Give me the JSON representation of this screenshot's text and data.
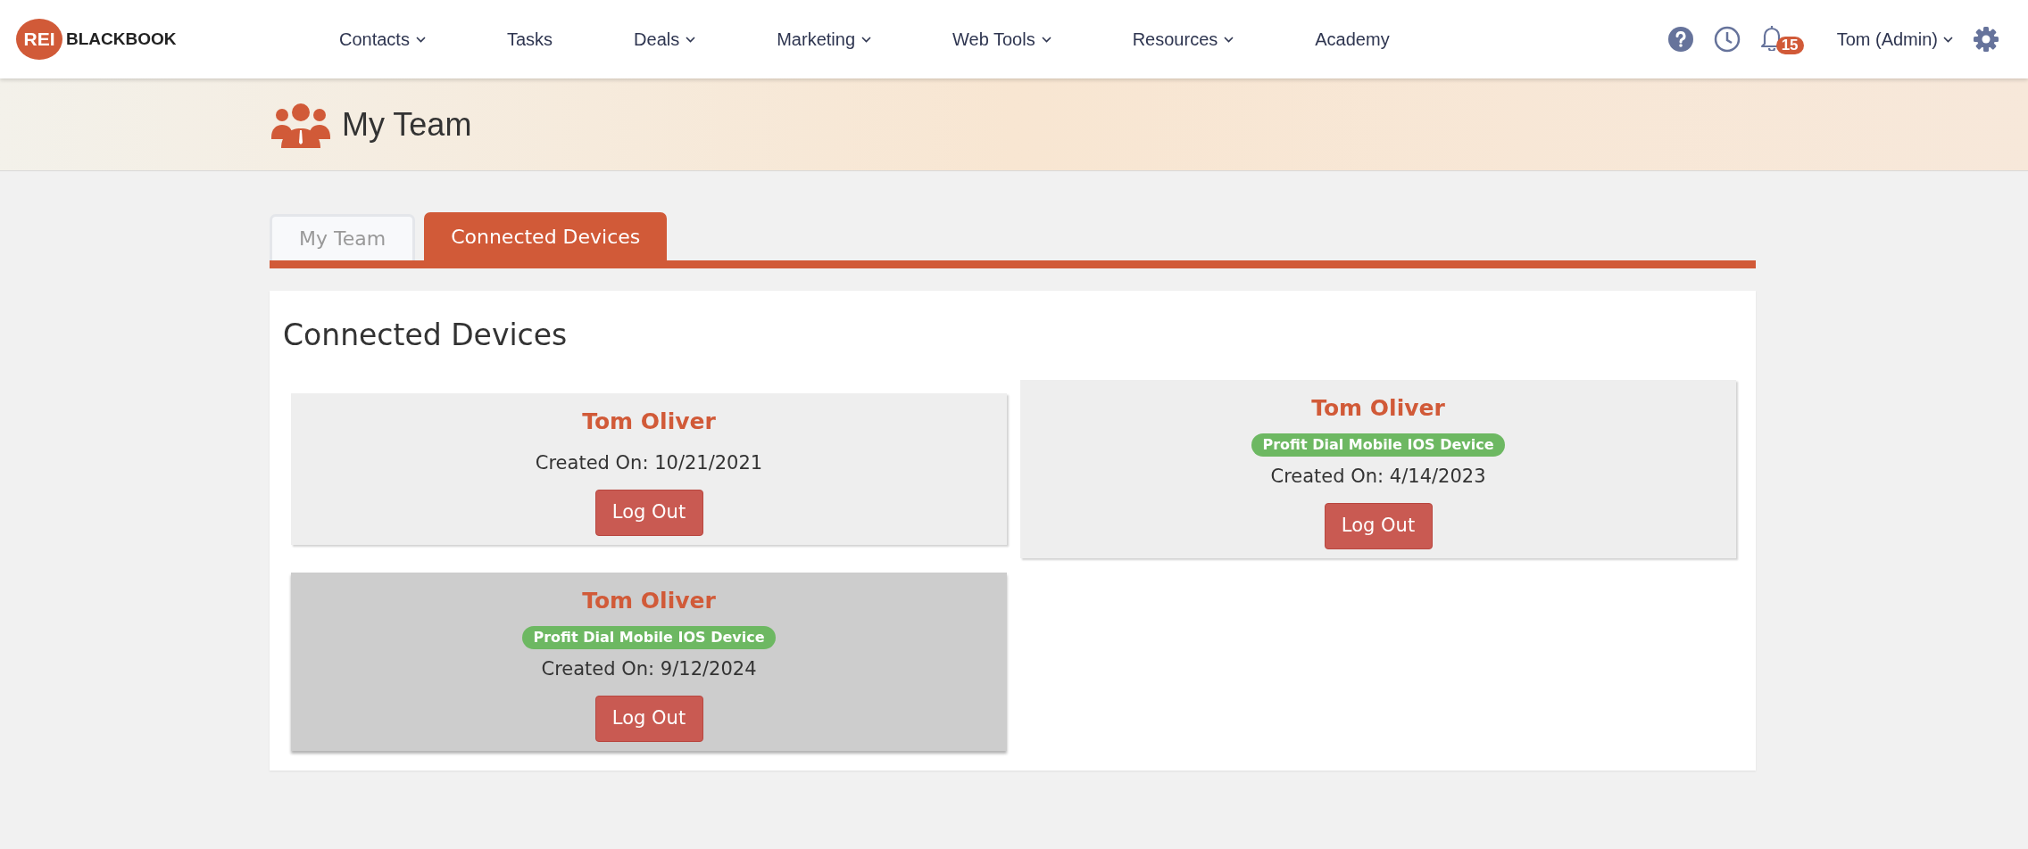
{
  "logo": {
    "badge": "REI",
    "name": "BLACKBOOK"
  },
  "nav": [
    {
      "label": "Contacts",
      "dropdown": true
    },
    {
      "label": "Tasks",
      "dropdown": false
    },
    {
      "label": "Deals",
      "dropdown": true
    },
    {
      "label": "Marketing",
      "dropdown": true
    },
    {
      "label": "Web Tools",
      "dropdown": true
    },
    {
      "label": "Resources",
      "dropdown": true
    },
    {
      "label": "Academy",
      "dropdown": false
    }
  ],
  "notifications": {
    "count": "15"
  },
  "user": {
    "label": "Tom (Admin)"
  },
  "page_title": "My Team",
  "tabs": [
    {
      "label": "My Team",
      "selected": false
    },
    {
      "label": "Connected Devices",
      "selected": true
    }
  ],
  "section_title": "Connected Devices",
  "devices": [
    {
      "name": "Tom Oliver",
      "created": "Created On: 10/21/2021",
      "button": "Log Out",
      "highlighted": false
    },
    {
      "name": "Tom Oliver",
      "tag": "Profit Dial Mobile IOS Device",
      "created": "Created On: 4/14/2023",
      "button": "Log Out",
      "highlighted": false
    },
    {
      "name": "Tom Oliver",
      "tag": "Profit Dial Mobile IOS Device",
      "created": "Created On: 9/12/2024",
      "button": "Log Out",
      "highlighted": true
    }
  ]
}
